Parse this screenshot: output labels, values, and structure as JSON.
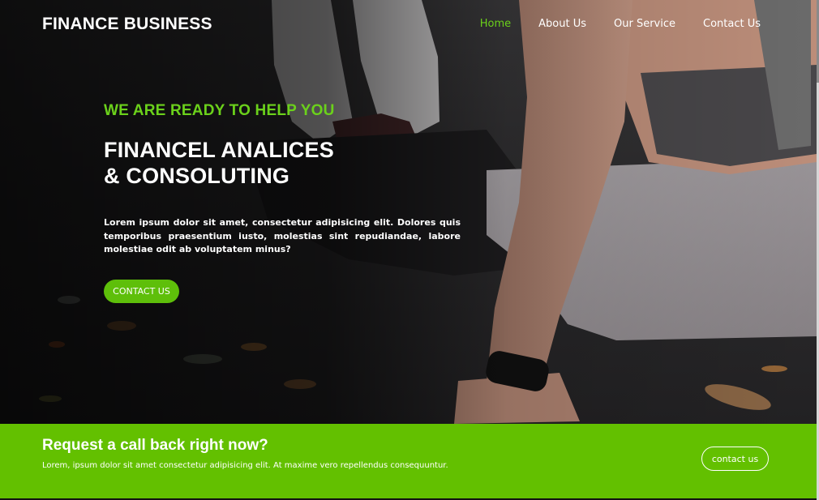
{
  "brand": {
    "title": "FINANCE BUSINESS"
  },
  "nav": {
    "items": [
      {
        "label": "Home",
        "active": true
      },
      {
        "label": "About Us",
        "active": false
      },
      {
        "label": "Our Service",
        "active": false
      },
      {
        "label": "Contact Us",
        "active": false
      }
    ]
  },
  "hero": {
    "kicker": "WE ARE READY TO HELP YOU",
    "headline_line1": "FINANCEL ANALICES",
    "headline_line2": "& CONSOLUTING",
    "lead": "Lorem ipsum dolor sit amet, consectetur adipisicing elit. Dolores quis temporibus praesentium iusto, molestias sint repudiandae, labore molestiae odit ab voluptatem minus?",
    "cta_label": "CONTACT US"
  },
  "callback": {
    "title": "Request a call back right now?",
    "text": "Lorem, ipsum dolor sit amet consectetur adipisicing elit. At maxime vero repellendus consequuntur.",
    "button_label": "contact us"
  },
  "colors": {
    "accent": "#6bd11b",
    "strip": "#63c000"
  }
}
